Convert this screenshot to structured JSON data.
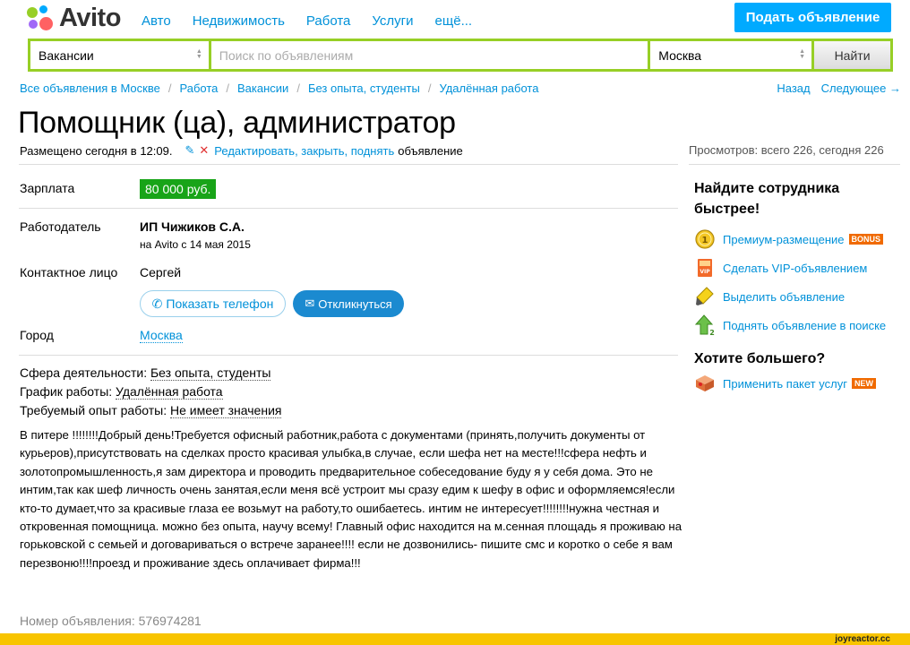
{
  "header": {
    "logo_text": "Avito",
    "nav": [
      "Авто",
      "Недвижимость",
      "Работа",
      "Услуги",
      "ещё..."
    ],
    "post_button": "Подать объявление"
  },
  "search": {
    "category": "Вакансии",
    "query_placeholder": "Поиск по объявлениям",
    "city": "Москва",
    "find_button": "Найти"
  },
  "breadcrumbs": [
    "Все объявления в Москве",
    "Работа",
    "Вакансии",
    "Без опыта, студенты",
    "Удалённая работа"
  ],
  "pager": {
    "back": "Назад",
    "next": "Следующее →"
  },
  "ad": {
    "title": "Помощник (ца), администратор",
    "posted": "Размещено сегодня в 12:09.",
    "edit_link": "Редактировать, закрыть, поднять",
    "edit_suffix": "объявление",
    "views": "Просмотров: всего 226, сегодня 226",
    "salary_label": "Зарплата",
    "salary": "80 000 руб.",
    "employer_label": "Работодатель",
    "employer": "ИП Чижиков С.А.",
    "employer_since": "на Avito с 14 мая 2015",
    "contact_label": "Контактное лицо",
    "contact": "Сергей",
    "show_phone": "Показать телефон",
    "respond": "Откликнуться",
    "city_label": "Город",
    "city": "Москва",
    "params": [
      {
        "label": "Сфера деятельности:",
        "value": "Без опыта, студенты"
      },
      {
        "label": "График работы:",
        "value": "Удалённая работа"
      },
      {
        "label": "Требуемый опыт работы:",
        "value": "Не имеет значения"
      }
    ],
    "description": "В питере !!!!!!!!Добрый день!Требуется офисный работник,работа с документами (принять,получить документы от курьеров),присутствовать на сделках просто красивая улыбка,в случае, если шефа нет на месте!!!сфера нефть и золотопромышленность,я зам директора и проводить предварительное собеседование буду я у себя дома. Это не интим,так как шеф личность очень занятая,если меня всё устроит мы сразу едим к шефу в офис и оформляемся!если кто-то думает,что за красивые глаза ее возьмут на работу,то ошибаетесь. интим не интересует!!!!!!!!нужна честная и откровенная помощница. можно без опыта, научу всему! Главный офис находится на м.сенная площадь я проживаю на горьковской с семьей и договариваться о встрече заранее!!!! если не дозвонились- пишите смс и коротко о себе я вам перезвоню!!!!проезд и проживание здесь оплачивает фирма!!!",
    "ad_number": "Номер объявления: 576974281"
  },
  "sidebar": {
    "heading1": "Найдите сотрудника быстрее!",
    "items": [
      {
        "label": "Премиум-размещение",
        "badge": "BONUS",
        "icon": "premium-coin-icon"
      },
      {
        "label": "Сделать VIP-объявлением",
        "badge": "",
        "icon": "vip-icon"
      },
      {
        "label": "Выделить объявление",
        "badge": "",
        "icon": "highlight-marker-icon"
      },
      {
        "label": "Поднять объявление в поиске",
        "badge": "",
        "icon": "lift-arrow-icon"
      }
    ],
    "heading2": "Хотите большего?",
    "package": {
      "label": "Применить пакет услуг",
      "badge": "NEW",
      "icon": "package-box-icon"
    }
  },
  "watermark": "joyreactor.cc",
  "colors": {
    "accent": "#0091d9",
    "brand_green": "#97cf26",
    "salary_green": "#18a418",
    "post_button": "#00aaff"
  }
}
